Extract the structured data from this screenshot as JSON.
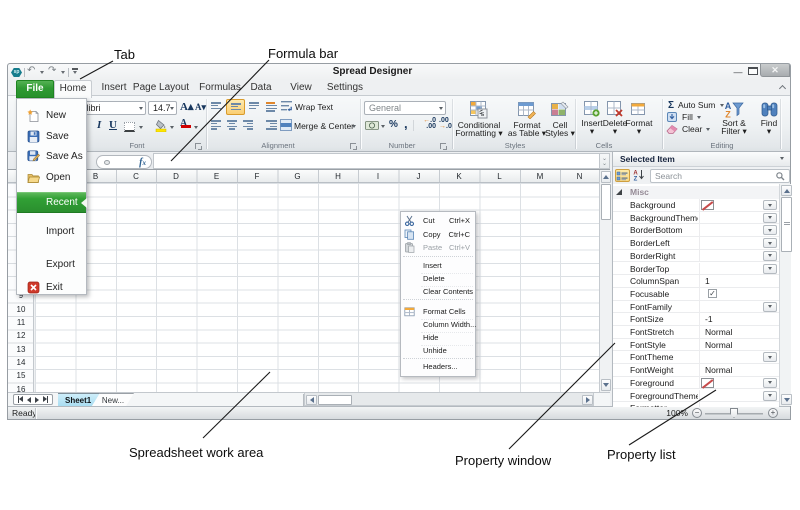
{
  "window": {
    "title": "Spread Designer"
  },
  "tabs": {
    "file": "File",
    "items": [
      "Home",
      "Insert",
      "Page Layout",
      "Formulas",
      "Data",
      "View",
      "Settings"
    ]
  },
  "ribbon": {
    "font": {
      "group": "Font",
      "name_value": "Calibri",
      "size_value": "14.7"
    },
    "alignment": {
      "group": "Alignment",
      "wrap_text": "Wrap Text",
      "merge_center": "Merge & Center"
    },
    "number": {
      "group": "Number",
      "format_value": "General"
    },
    "styles": {
      "group": "Styles",
      "cond1": "Conditional",
      "cond2": "Formatting",
      "fat1": "Format",
      "fat2": "as Table",
      "cs1": "Cell",
      "cs2": "Styles"
    },
    "cells": {
      "group": "Cells",
      "insert": "Insert",
      "delete": "Delete",
      "format": "Format"
    },
    "editing": {
      "group": "Editing",
      "auto_sum": "Auto Sum",
      "fill": "Fill",
      "clear": "Clear",
      "sort1": "Sort &",
      "sort2": "Filter",
      "find": "Find"
    }
  },
  "file_menu": {
    "items": {
      "new": "New",
      "save": "Save",
      "save_as": "Save As",
      "open": "Open",
      "recent": "Recent",
      "import": "Import",
      "export": "Export",
      "exit": "Exit"
    }
  },
  "grid": {
    "columns": [
      "B",
      "C",
      "D",
      "E",
      "F",
      "G",
      "H",
      "I",
      "J",
      "K",
      "L",
      "M",
      "N"
    ],
    "rows": [
      "9",
      "10",
      "11",
      "12",
      "13",
      "14",
      "15",
      "16"
    ]
  },
  "context_menu": {
    "items": [
      {
        "label": "Cut",
        "shortcut": "Ctrl+X"
      },
      {
        "label": "Copy",
        "shortcut": "Ctrl+C"
      },
      {
        "label": "Paste",
        "shortcut": "Ctrl+V"
      },
      {
        "label": "Insert",
        "shortcut": ""
      },
      {
        "label": "Delete",
        "shortcut": ""
      },
      {
        "label": "Clear Contents",
        "shortcut": ""
      },
      {
        "label": "Format Cells",
        "shortcut": ""
      },
      {
        "label": "Column Width...",
        "shortcut": ""
      },
      {
        "label": "Hide",
        "shortcut": ""
      },
      {
        "label": "Unhide",
        "shortcut": ""
      },
      {
        "label": "Headers...",
        "shortcut": ""
      }
    ]
  },
  "sheet_bar": {
    "sheet1": "Sheet1",
    "new_sheet": "New..."
  },
  "status_bar": {
    "ready": "Ready",
    "zoom": "100%"
  },
  "property_panel": {
    "header": "Selected Item",
    "search_placeholder": "Search",
    "category": "Misc",
    "rows": [
      {
        "name": "Background",
        "value": ""
      },
      {
        "name": "BackgroundThemeCc",
        "value": ""
      },
      {
        "name": "BorderBottom",
        "value": ""
      },
      {
        "name": "BorderLeft",
        "value": ""
      },
      {
        "name": "BorderRight",
        "value": ""
      },
      {
        "name": "BorderTop",
        "value": ""
      },
      {
        "name": "ColumnSpan",
        "value": "1"
      },
      {
        "name": "Focusable",
        "value": ""
      },
      {
        "name": "FontFamily",
        "value": ""
      },
      {
        "name": "FontSize",
        "value": "-1"
      },
      {
        "name": "FontStretch",
        "value": "Normal"
      },
      {
        "name": "FontStyle",
        "value": "Normal"
      },
      {
        "name": "FontTheme",
        "value": ""
      },
      {
        "name": "FontWeight",
        "value": "Normal"
      },
      {
        "name": "Foreground",
        "value": ""
      },
      {
        "name": "ForegroundThemeCc",
        "value": ""
      },
      {
        "name": "Formatter",
        "value": ""
      }
    ]
  },
  "annotations": {
    "tab": "Tab",
    "formula_bar": "Formula bar",
    "work_area": "Spreadsheet work area",
    "property_window": "Property window",
    "property_list": "Property list"
  }
}
